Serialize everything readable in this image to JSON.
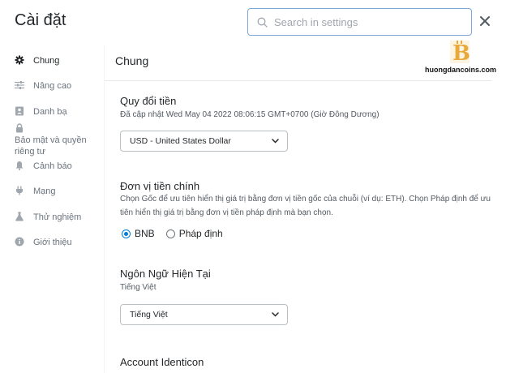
{
  "header": {
    "title": "Cài đặt",
    "search_placeholder": "Search in settings"
  },
  "sidebar": {
    "items": [
      {
        "label": "Chung",
        "icon": "gear-icon"
      },
      {
        "label": "Nâng cao",
        "icon": "sliders-icon"
      },
      {
        "label": "Danh bạ",
        "icon": "contacts-icon"
      },
      {
        "label": "Bảo mật và quyền riêng tư",
        "icon": "lock-icon"
      },
      {
        "label": "Cảnh báo",
        "icon": "bell-icon"
      },
      {
        "label": "Mạng",
        "icon": "plug-icon"
      },
      {
        "label": "Thử nghiệm",
        "icon": "flask-icon"
      },
      {
        "label": "Giới thiệu",
        "icon": "info-icon"
      }
    ]
  },
  "main": {
    "section_title": "Chung",
    "currency": {
      "heading": "Quy đổi tiền",
      "updated": "Đã cập nhật Wed May 04 2022 08:06:15 GMT+0700 (Giờ Đông Dương)",
      "selected": "USD - United States Dollar"
    },
    "primary_currency": {
      "heading": "Đơn vị tiền chính",
      "description": "Chọn Gốc để ưu tiên hiển thị giá trị bằng đơn vị tiền gốc của chuỗi (ví dụ: ETH). Chọn Pháp định để ưu tiên hiển thị giá trị bằng đơn vị tiền pháp định mà bạn chọn.",
      "options": [
        "BNB",
        "Pháp định"
      ],
      "checked": "BNB"
    },
    "language": {
      "heading": "Ngôn Ngữ Hiện Tại",
      "current": "Tiếng Việt",
      "selected": "Tiếng Việt"
    },
    "identicon": {
      "heading": "Account Identicon"
    }
  },
  "watermark": {
    "logo_letter": "B",
    "text": "huongdancoins.com"
  },
  "colors": {
    "accent": "#037dd6",
    "search_border": "#7ba7d9",
    "logo_gold": "#e8a93a"
  }
}
